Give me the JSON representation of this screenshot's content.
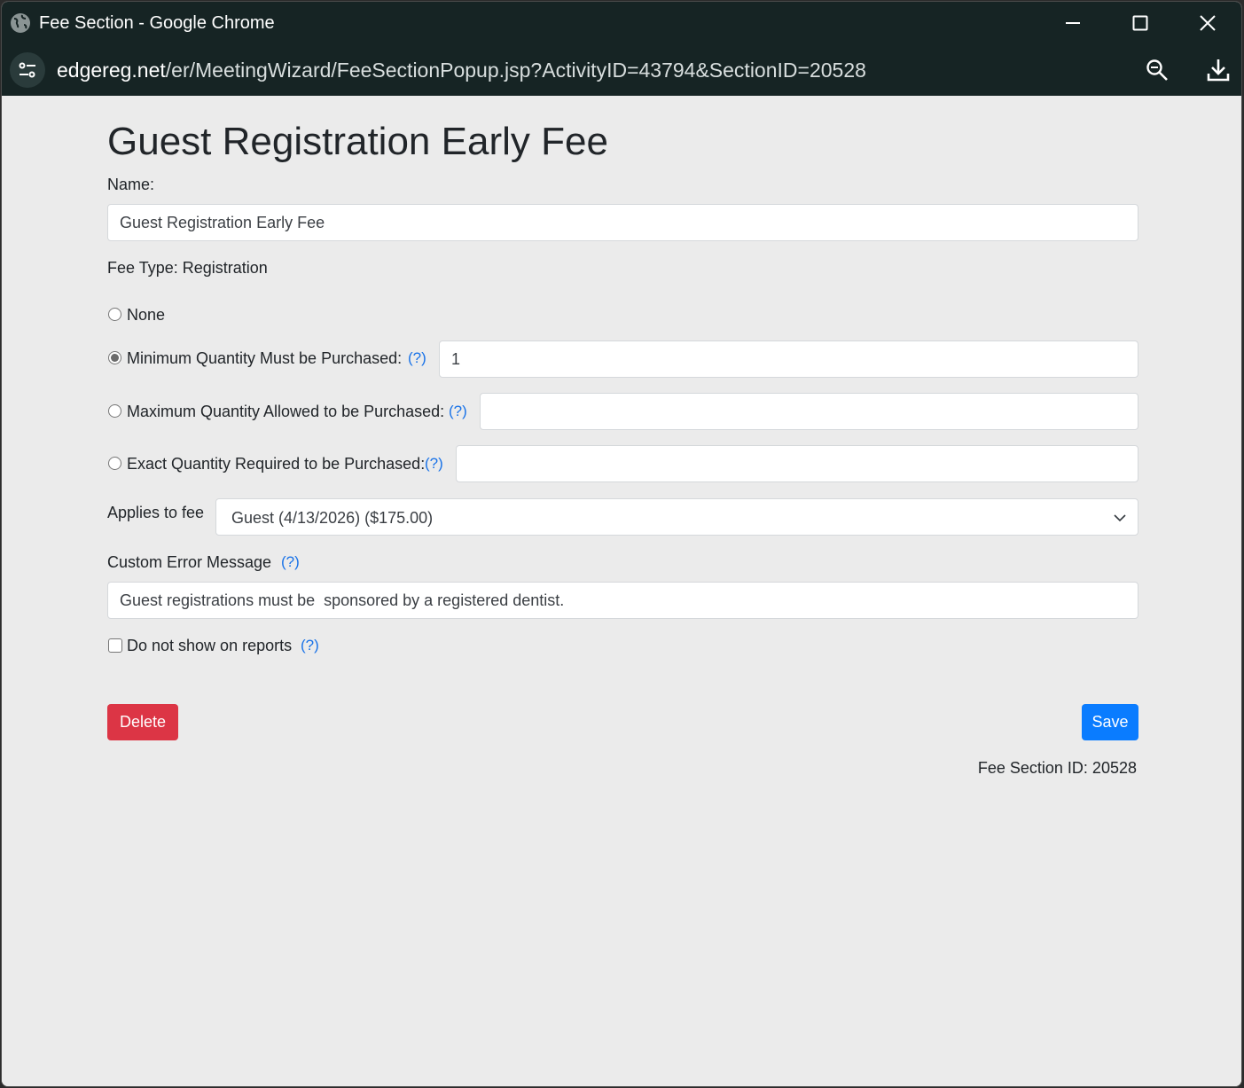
{
  "window": {
    "title": "Fee Section - Google Chrome",
    "url_domain": "edgereg.net",
    "url_path": "/er/MeetingWizard/FeeSectionPopup.jsp?ActivityID=43794&SectionID=20528"
  },
  "page": {
    "title": "Guest Registration Early Fee",
    "name_label": "Name:",
    "name_value": "Guest Registration Early Fee",
    "fee_type": "Fee Type: Registration"
  },
  "quantity_options": {
    "none_label": "None",
    "minimum_label": "Minimum Quantity Must be Purchased:",
    "minimum_value": "1",
    "maximum_label": "Maximum Quantity Allowed to be Purchased:",
    "maximum_value": "",
    "exact_label": "Exact Quantity Required to be Purchased:",
    "exact_value": "",
    "selected": "minimum",
    "help": "(?)"
  },
  "applies": {
    "label": "Applies to fee",
    "selected": "Guest (4/13/2026) ($175.00)"
  },
  "error_message": {
    "label": "Custom Error Message",
    "value": "Guest registrations must be  sponsored by a registered dentist."
  },
  "reports": {
    "label": "Do not show on reports",
    "checked": false
  },
  "actions": {
    "delete_label": "Delete",
    "save_label": "Save"
  },
  "footer": {
    "fee_section_id": "Fee Section ID: 20528"
  },
  "colors": {
    "titlebar": "#162424",
    "delete": "#dc3545",
    "save": "#0a7cff",
    "help_link": "#1a73e8",
    "page_bg": "#ebebeb"
  },
  "icons": [
    "globe-icon",
    "minimize-icon",
    "maximize-icon",
    "close-icon",
    "site-settings-icon",
    "zoom-icon",
    "download-icon",
    "chevron-down-icon"
  ]
}
